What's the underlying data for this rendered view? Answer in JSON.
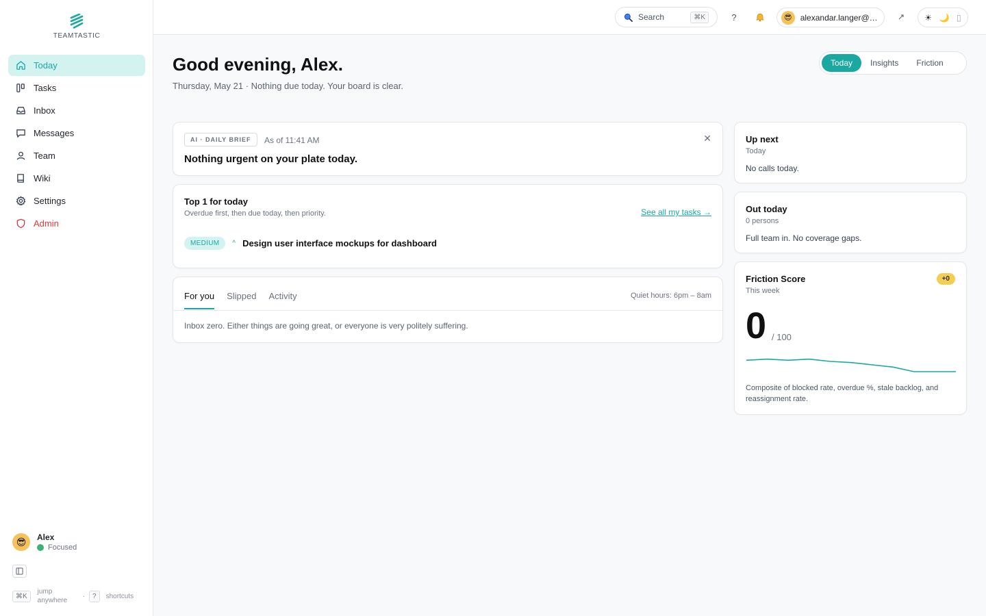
{
  "brand": {
    "name": "TEAMTASTIC",
    "accent": "#1aa8a0"
  },
  "sidebar": {
    "items": [
      {
        "label": "Today",
        "icon": "home-icon",
        "active": true
      },
      {
        "label": "Tasks",
        "icon": "board-icon"
      },
      {
        "label": "Inbox",
        "icon": "inbox-icon"
      },
      {
        "label": "Messages",
        "icon": "message-icon"
      },
      {
        "label": "Team",
        "icon": "user-icon"
      },
      {
        "label": "Wiki",
        "icon": "book-icon"
      },
      {
        "label": "Settings",
        "icon": "gear-icon"
      },
      {
        "label": "Admin",
        "icon": "shield-icon",
        "color": "#d93b3b"
      }
    ],
    "user": {
      "name": "Alex",
      "status": "Focused"
    },
    "shortcuts": {
      "jump_key": "⌘K",
      "jump_label": "jump anywhere",
      "help_key": "?",
      "help_label": "shortcuts"
    }
  },
  "topbar": {
    "search_label": "Search",
    "search_shortcut": "⌘K",
    "help": "?",
    "account_email": "alexandar.langer@g...",
    "theme_options": [
      "☀",
      "🌙",
      "▯"
    ]
  },
  "header": {
    "greeting": "Good evening, Alex.",
    "subline": "Thursday, May 21 · Nothing due today. Your board is clear.",
    "tabs": [
      {
        "label": "Today",
        "active": true
      },
      {
        "label": "Insights"
      },
      {
        "label": "Friction"
      }
    ]
  },
  "brief": {
    "badge": "AI · DAILY BRIEF",
    "as_of": "As of 11:41 AM",
    "text": "Nothing urgent on your plate today."
  },
  "top_tasks": {
    "title": "Top 1 for today",
    "subtitle": "Overdue first, then due today, then priority.",
    "see_all": "See all my tasks →",
    "tasks": [
      {
        "priority": "MEDIUM",
        "title": "Design user interface mockups for dashboard"
      }
    ]
  },
  "feed": {
    "tabs": [
      "For you",
      "Slipped",
      "Activity"
    ],
    "quiet_hours": "Quiet hours: 6pm – 8am",
    "empty_text": "Inbox zero. Either things are going great, or everyone is very politely suffering."
  },
  "up_next": {
    "title": "Up next",
    "subtitle": "Today",
    "body": "No calls today."
  },
  "out_today": {
    "title": "Out today",
    "subtitle": "0 persons",
    "body": "Full team in. No coverage gaps."
  },
  "friction": {
    "title": "Friction Score",
    "subtitle": "This week",
    "delta": "+0",
    "score": "0",
    "max": "/ 100",
    "description": "Composite of blocked rate, overdue %, stale backlog, and reassignment rate.",
    "trend": [
      0.1,
      0.11,
      0.1,
      0.11,
      0.09,
      0.08,
      0.06,
      0.04,
      0.0,
      0.0,
      0.0
    ]
  }
}
